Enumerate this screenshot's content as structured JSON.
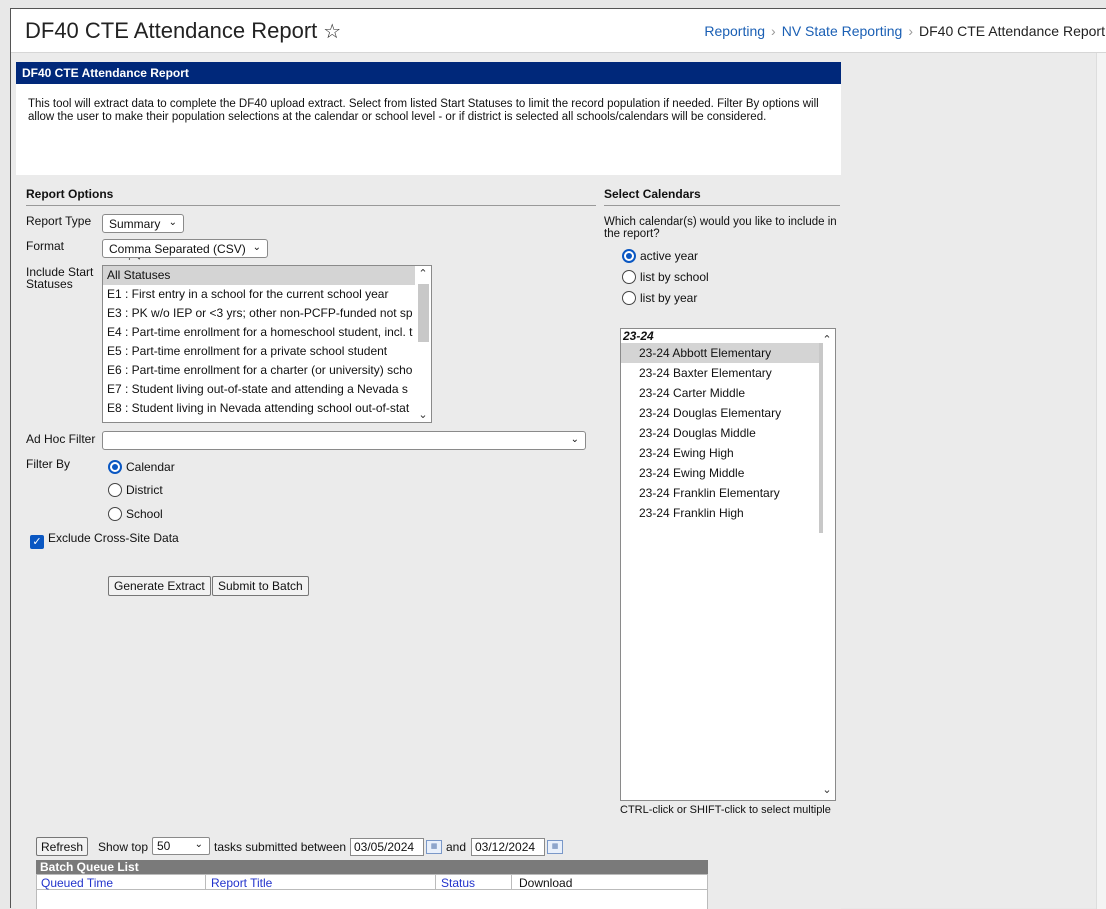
{
  "header": {
    "title": "DF40 CTE Attendance Report",
    "breadcrumb": [
      "Reporting",
      "NV State Reporting",
      "DF40 CTE Attendance Report"
    ]
  },
  "panel": {
    "bar_title": "DF40 CTE Attendance Report",
    "description": "This tool will extract data to complete the DF40 upload extract. Select from listed Start Statuses to limit the record population if needed. Filter By options will allow the user to make their population selections at the calendar or school level - or if district is selected all schools/calendars will be considered."
  },
  "report_options": {
    "title": "Report Options",
    "report_type_label": "Report Type",
    "report_type_value": "Summary",
    "format_label": "Format",
    "format_value": "Comma Separated (CSV)",
    "start_status_label": "Include Start Statuses",
    "start_statuses": [
      "All Statuses",
      "E1 : First entry in a school for the current school year",
      "E3 : PK w/o IEP or <3 yrs; other non-PCFP-funded not sp",
      "E4 : Part-time enrollment for a homeschool student, incl. t",
      "E5 : Part-time enrollment for a private school student",
      "E6 : Part-time enrollment for a charter (or university) scho",
      "E7 : Student living out-of-state and attending a Nevada s",
      "E8 : Student living in Nevada attending school out-of-stat"
    ],
    "ad_hoc_label": "Ad Hoc Filter",
    "ad_hoc_value": "",
    "filter_by_label": "Filter By",
    "filter_by_options": [
      "Calendar",
      "District",
      "School"
    ],
    "filter_by_selected": "Calendar",
    "exclude_label": "Exclude Cross-Site Data",
    "exclude_checked": true,
    "generate_label": "Generate Extract",
    "submit_label": "Submit to Batch"
  },
  "select_calendars": {
    "title": "Select Calendars",
    "question": "Which calendar(s) would you like to include in the report?",
    "modes": [
      "active year",
      "list by school",
      "list by year"
    ],
    "mode_selected": "active year",
    "group_label": "23-24",
    "calendars": [
      "23-24 Abbott Elementary",
      "23-24 Baxter Elementary",
      "23-24 Carter Middle",
      "23-24 Douglas Elementary",
      "23-24 Douglas Middle",
      "23-24 Ewing High",
      "23-24 Ewing Middle",
      "23-24 Franklin Elementary",
      "23-24 Franklin High"
    ],
    "hint": "CTRL-click or SHIFT-click to select multiple"
  },
  "batch": {
    "refresh_label": "Refresh",
    "show_top_label": "Show top",
    "show_top_value": "50",
    "between_label": "tasks submitted between",
    "start_date": "03/05/2024",
    "and_label": "and",
    "end_date": "03/12/2024",
    "list_title": "Batch Queue List",
    "columns": [
      "Queued Time",
      "Report Title",
      "Status",
      "Download"
    ]
  }
}
